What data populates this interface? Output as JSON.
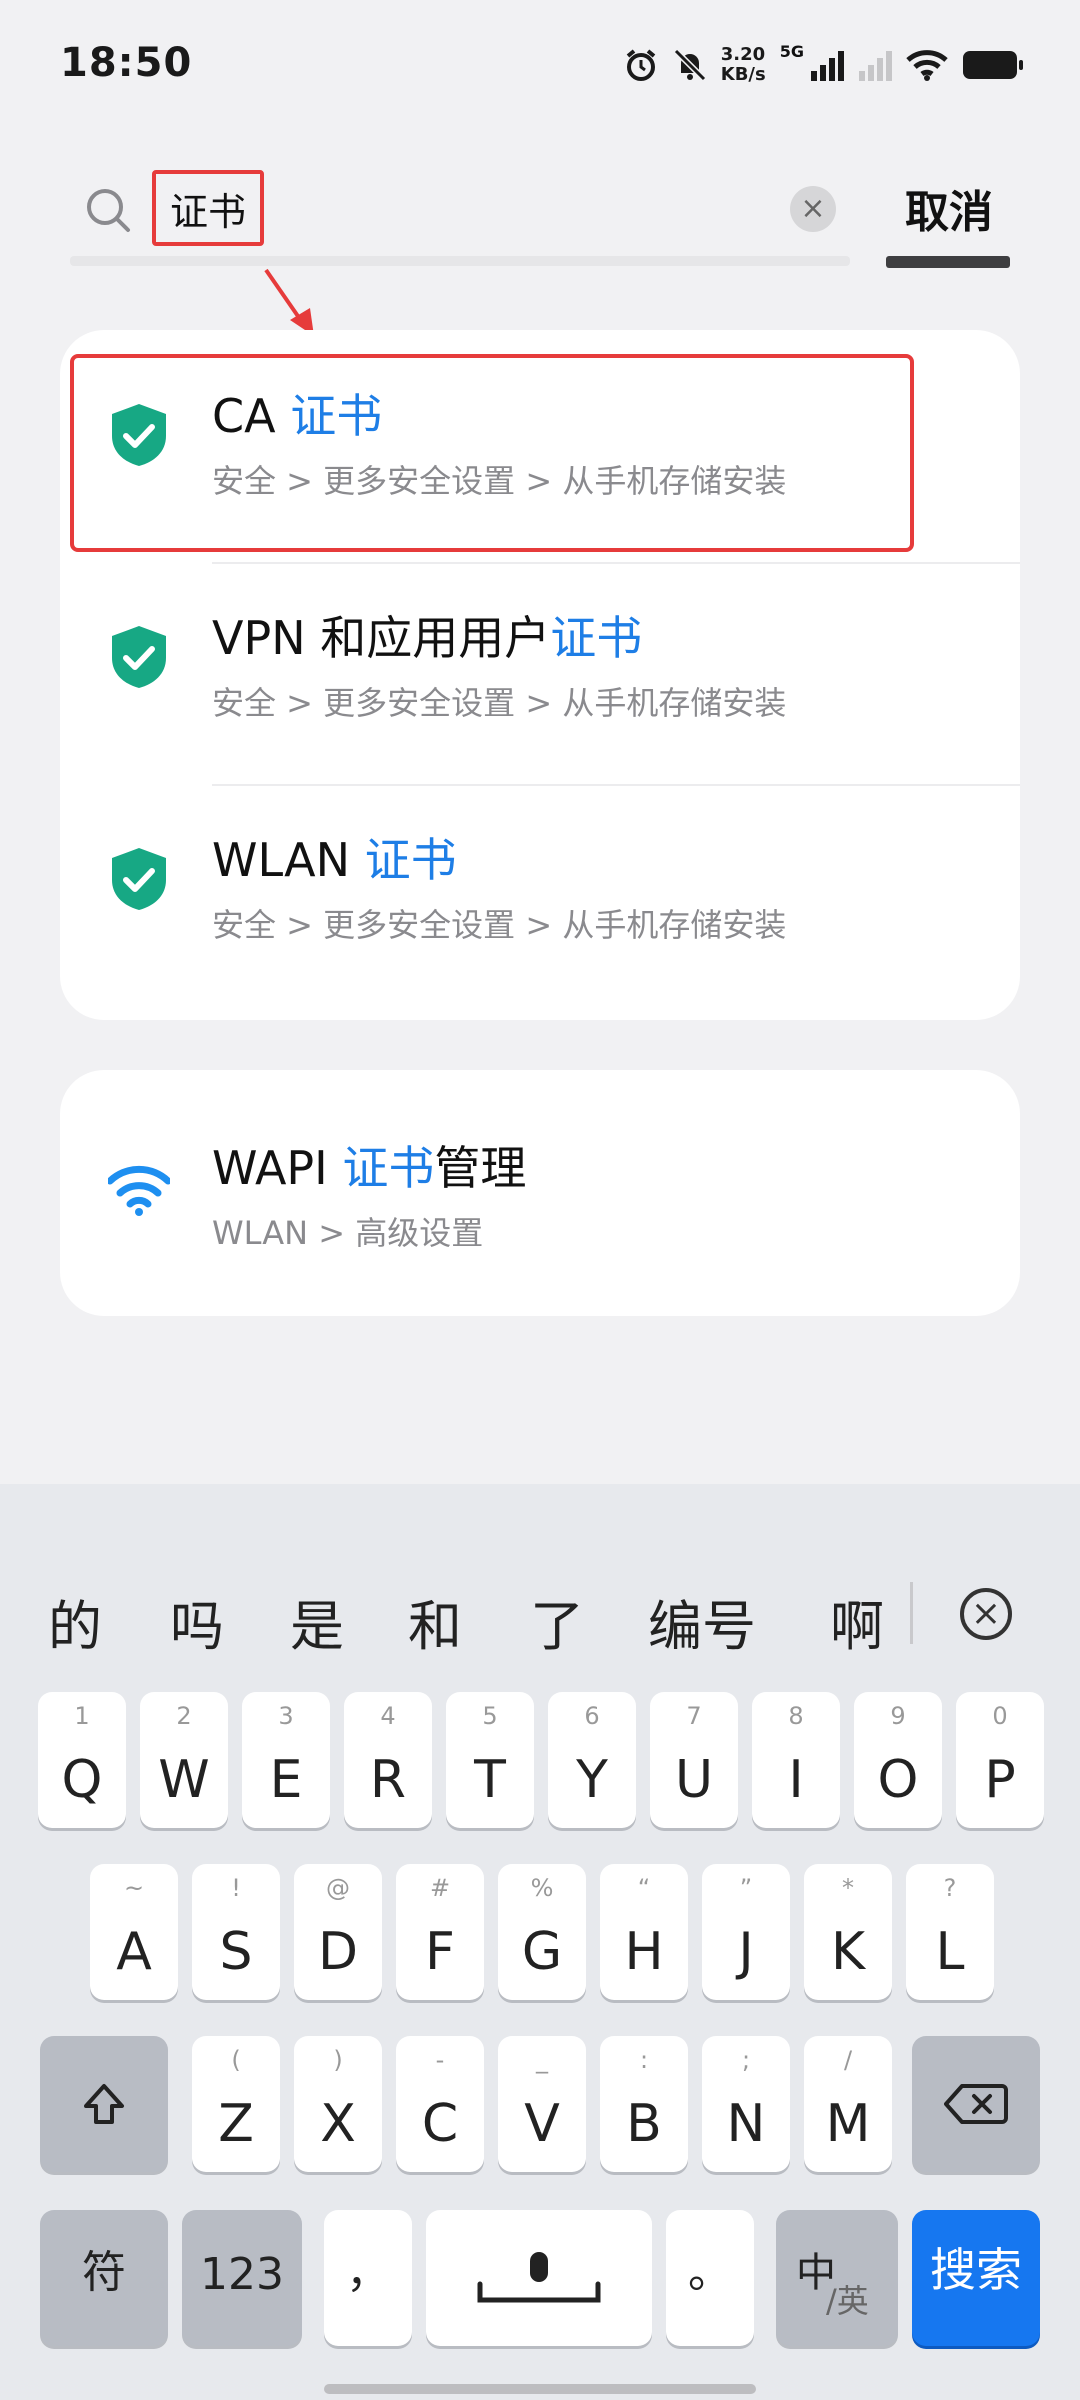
{
  "status_bar": {
    "time": "18:50",
    "speed_value": "3.20",
    "speed_unit": "KB/s",
    "network": "5G"
  },
  "search": {
    "query": "证书",
    "cancel_label": "取消"
  },
  "results": [
    {
      "title_prefix": "CA ",
      "title_highlight": "证书",
      "title_suffix": "",
      "path": "安全 > 更多安全设置 > 从手机存储安装",
      "icon": "shield-check-icon"
    },
    {
      "title_prefix": "VPN 和应用用户",
      "title_highlight": "证书",
      "title_suffix": "",
      "path": "安全 > 更多安全设置 > 从手机存储安装",
      "icon": "shield-check-icon"
    },
    {
      "title_prefix": "WLAN ",
      "title_highlight": "证书",
      "title_suffix": "",
      "path": "安全 > 更多安全设置 > 从手机存储安装",
      "icon": "shield-check-icon"
    }
  ],
  "result_wapi": {
    "title_prefix": "WAPI ",
    "title_highlight": "证书",
    "title_suffix": "管理",
    "path": "WLAN > 高级设置",
    "icon": "wifi-icon"
  },
  "keyboard": {
    "candidates": [
      "的",
      "吗",
      "是",
      "和",
      "了",
      "编号",
      "啊"
    ],
    "row1": [
      {
        "main": "Q",
        "sub": "1"
      },
      {
        "main": "W",
        "sub": "2"
      },
      {
        "main": "E",
        "sub": "3"
      },
      {
        "main": "R",
        "sub": "4"
      },
      {
        "main": "T",
        "sub": "5"
      },
      {
        "main": "Y",
        "sub": "6"
      },
      {
        "main": "U",
        "sub": "7"
      },
      {
        "main": "I",
        "sub": "8"
      },
      {
        "main": "O",
        "sub": "9"
      },
      {
        "main": "P",
        "sub": "0"
      }
    ],
    "row2": [
      {
        "main": "A",
        "sub": "~"
      },
      {
        "main": "S",
        "sub": "!"
      },
      {
        "main": "D",
        "sub": "@"
      },
      {
        "main": "F",
        "sub": "#"
      },
      {
        "main": "G",
        "sub": "%"
      },
      {
        "main": "H",
        "sub": "“"
      },
      {
        "main": "J",
        "sub": "”"
      },
      {
        "main": "K",
        "sub": "*"
      },
      {
        "main": "L",
        "sub": "?"
      }
    ],
    "row3": [
      {
        "main": "Z",
        "sub": "("
      },
      {
        "main": "X",
        "sub": ")"
      },
      {
        "main": "C",
        "sub": "-"
      },
      {
        "main": "V",
        "sub": "_"
      },
      {
        "main": "B",
        "sub": ":"
      },
      {
        "main": "N",
        "sub": ";"
      },
      {
        "main": "M",
        "sub": "/"
      }
    ],
    "symbols_label": "符",
    "numbers_label": "123",
    "comma_label": "，",
    "period_label": "。",
    "lang_primary": "中",
    "lang_secondary": "/英",
    "search_label": "搜索"
  }
}
